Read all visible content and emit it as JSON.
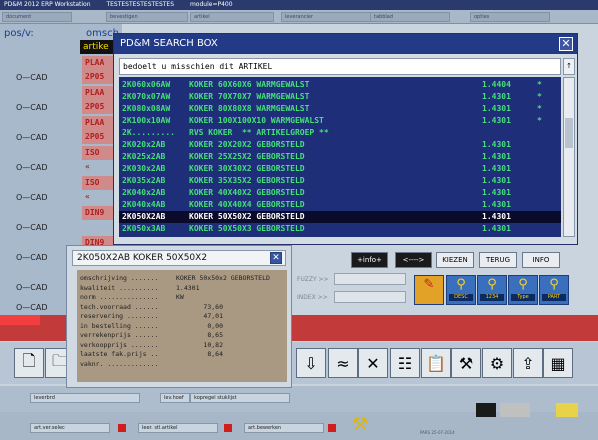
{
  "window": {
    "title_parts": [
      "PD&M 2012 ERP Workstation",
      "TESTESTESTESTESTES",
      "module=P400"
    ]
  },
  "menubar": {
    "cells": [
      "document",
      "bevestigen",
      "artikel",
      "leverancier",
      "tabblad",
      "opties"
    ]
  },
  "background": {
    "pos_label": "pos/v:",
    "omsch_label": "omsch",
    "artikel_tab": "artike",
    "cad_label": "CAD",
    "rows": [
      "PLAA",
      "2P05",
      "PLAA",
      "2P05",
      "PLAA",
      "2P05",
      "ISO",
      "«",
      "ISO",
      "«",
      "DIN9",
      "",
      "DIN9"
    ]
  },
  "search": {
    "title": "PD&M SEARCH BOX",
    "close": "✕",
    "query": "bedoelt u misschien dit ARTIKEL",
    "scroll_up": "↑",
    "scroll_down": "↓",
    "results": [
      {
        "code": "2K060x06AW",
        "desc": "KOKER 60X60X6 WARMGEWALST",
        "mat": "1.4404",
        "flag": "*"
      },
      {
        "code": "2K070x07AW",
        "desc": "KOKER 70X70X7 WARMGEWALST",
        "mat": "1.4301",
        "flag": "*"
      },
      {
        "code": "2K080x08AW",
        "desc": "KOKER 80X80X8 WARMGEWALST",
        "mat": "1.4301",
        "flag": "*"
      },
      {
        "code": "2K100x10AW",
        "desc": "KOKER 100X100X10 WARMGEWALST",
        "mat": "1.4301",
        "flag": "*"
      },
      {
        "code": "2K.........",
        "desc": "RVS KOKER  ** ARTIKELGROEP **",
        "mat": "",
        "flag": ""
      },
      {
        "code": "2K020x2AB",
        "desc": "KOKER 20X20X2 GEBORSTELD",
        "mat": "1.4301",
        "flag": ""
      },
      {
        "code": "2K025x2AB",
        "desc": "KOKER 25X25X2 GEBORSTELD",
        "mat": "1.4301",
        "flag": ""
      },
      {
        "code": "2K030x2AB",
        "desc": "KOKER 30X30X2 GEBORSTELD",
        "mat": "1.4301",
        "flag": ""
      },
      {
        "code": "2K035x2AB",
        "desc": "KOKER 35X35X2 GEBORSTELD",
        "mat": "1.4301",
        "flag": ""
      },
      {
        "code": "2K040x2AB",
        "desc": "KOKER 40X40X2 GEBORSTELD",
        "mat": "1.4301",
        "flag": ""
      },
      {
        "code": "2K040x4AB",
        "desc": "KOKER 40X40X4 GEBORSTELD",
        "mat": "1.4301",
        "flag": ""
      },
      {
        "code": "2K050X2AB",
        "desc": "KOKER 50X50X2 GEBORSTELD",
        "mat": "1.4301",
        "flag": ""
      },
      {
        "code": "2K050x3AB",
        "desc": "KOKER 50X50X3 GEBORSTELD",
        "mat": "1.4301",
        "flag": ""
      }
    ],
    "selected_index": 11,
    "buttons": {
      "info_plus": "+info+",
      "arrows": "<---->",
      "kiezen": "KIEZEN",
      "terug": "TERUG",
      "info": "INFO"
    },
    "fuzzy_label": "FUZZY >>",
    "index_label": "INDEX >>",
    "tools": [
      {
        "name": "eraser",
        "label": ""
      },
      {
        "name": "desc",
        "label": "DESC"
      },
      {
        "name": "1234",
        "label": "1234"
      },
      {
        "name": "type",
        "label": "Type"
      },
      {
        "name": "part",
        "label": "PART"
      }
    ]
  },
  "detail": {
    "title": "2K050X2AB KOKER 50X50X2",
    "close": "✕",
    "lines": [
      {
        "label": "omschrijving .......",
        "value": "KOKER 50x50x2 GEBORSTELD"
      },
      {
        "label": "kwaliteit ..........",
        "value": "1.4301"
      },
      {
        "label": "norm ...............",
        "value": "KW"
      },
      {
        "label": "tech.voorraad ......",
        "value": "73,60"
      },
      {
        "label": "reservering ........",
        "value": "47,01"
      },
      {
        "label": "in bestelling ......",
        "value": "0,00"
      },
      {
        "label": "verrekenprijs ......",
        "value": "8,65"
      },
      {
        "label": "verkoopprijs .......",
        "value": "10,82"
      },
      {
        "label": "laatste fak.prijs ..",
        "value": "8,64"
      },
      {
        "label": "vaknr. .............",
        "value": ""
      }
    ]
  },
  "footer": {
    "field1": "leverbrd",
    "field2": "lev.hoef",
    "field3": "kopregel stuklijst",
    "field4": "art.ver.selec",
    "field5": "leer. stl.artikel",
    "field6": "art.bewerken",
    "date": "PARS 25-07-2014"
  }
}
